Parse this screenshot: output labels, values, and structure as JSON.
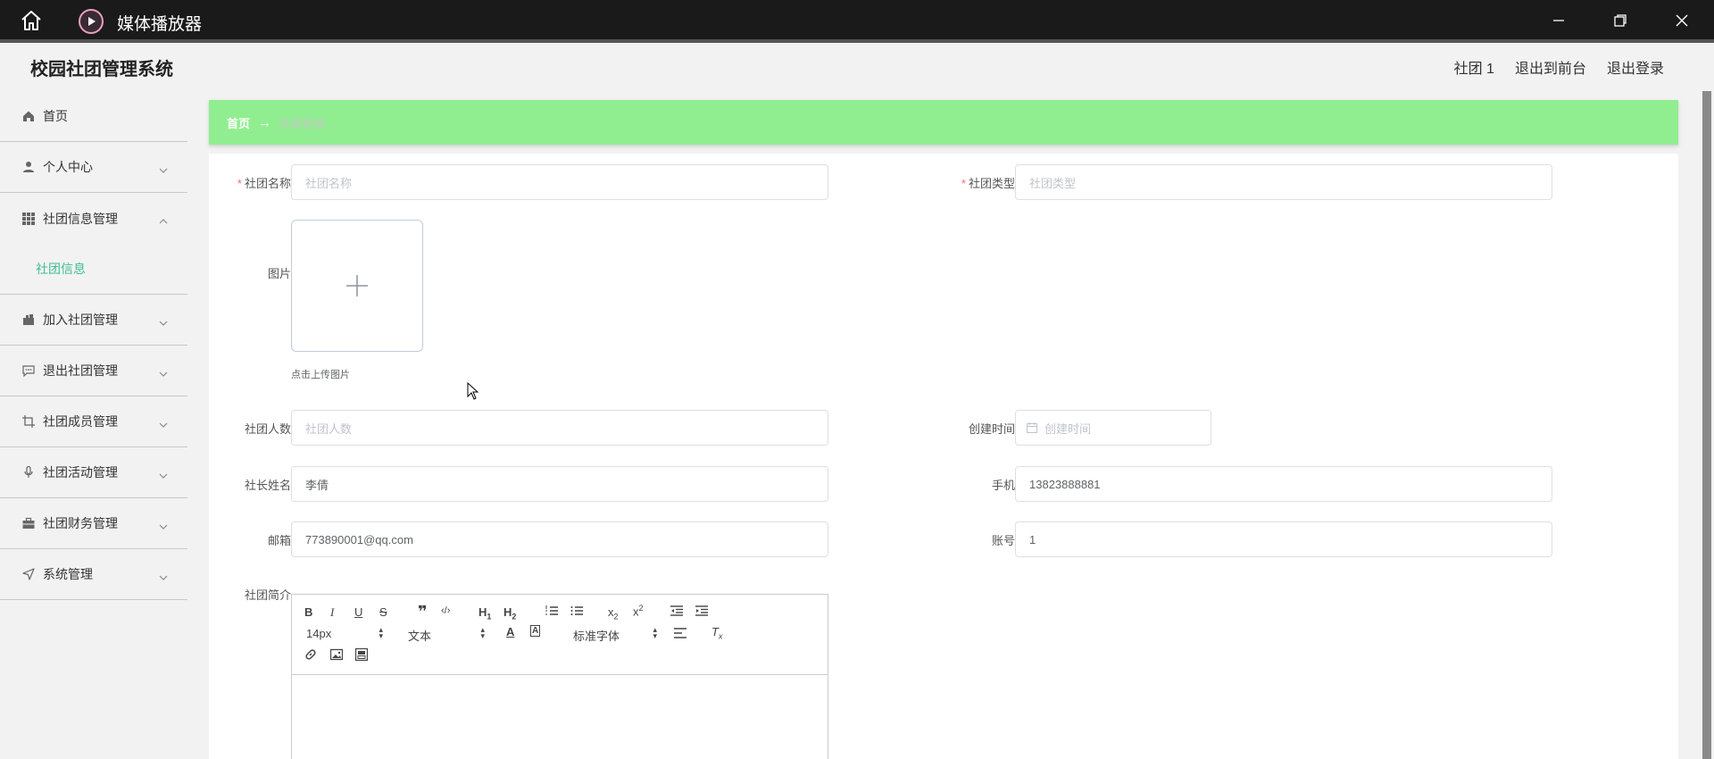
{
  "window": {
    "app_title": "媒体播放器"
  },
  "header": {
    "system_title": "校园社团管理系统",
    "links": [
      "社团 1",
      "退出到前台",
      "退出登录"
    ]
  },
  "sidebar": {
    "items": [
      {
        "label": "首页",
        "icon": "home-icon"
      },
      {
        "label": "个人中心",
        "icon": "user-icon"
      },
      {
        "label": "社团信息管理",
        "icon": "grid-icon"
      },
      {
        "label": "社团信息",
        "sub": true
      },
      {
        "label": "加入社团管理",
        "icon": "bag-icon"
      },
      {
        "label": "退出社团管理",
        "icon": "chat-icon"
      },
      {
        "label": "社团成员管理",
        "icon": "crop-icon"
      },
      {
        "label": "社团活动管理",
        "icon": "mic-icon"
      },
      {
        "label": "社团财务管理",
        "icon": "briefcase-icon"
      },
      {
        "label": "系统管理",
        "icon": "send-icon"
      }
    ]
  },
  "breadcrumb": {
    "home": "首页",
    "arrow": "→",
    "current": "社团信息"
  },
  "form": {
    "club_name": {
      "label": "社团名称",
      "placeholder": "社团名称",
      "required": true
    },
    "club_type": {
      "label": "社团类型",
      "placeholder": "社团类型",
      "required": true
    },
    "image": {
      "label": "图片",
      "tip": "点击上传图片"
    },
    "member_count": {
      "label": "社团人数",
      "placeholder": "社团人数"
    },
    "created_time": {
      "label": "创建时间",
      "placeholder": "创建时间"
    },
    "leader_name": {
      "label": "社长姓名",
      "value": "李倩"
    },
    "phone": {
      "label": "手机",
      "value": "13823888881"
    },
    "email": {
      "label": "邮箱",
      "value": "773890001@qq.com"
    },
    "account": {
      "label": "账号",
      "value": "1"
    },
    "intro": {
      "label": "社团简介"
    }
  },
  "editor": {
    "font_size": "14px",
    "format": "文本",
    "font_family": "标准字体"
  }
}
